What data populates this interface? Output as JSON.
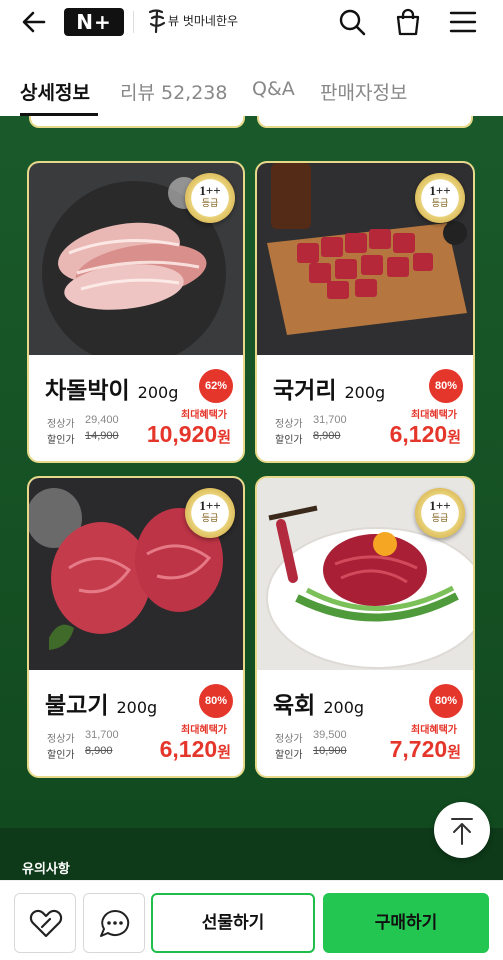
{
  "header": {
    "logo_text": "N+",
    "brand_name": "뷰 벗마네한우",
    "icons": [
      "back-arrow-icon",
      "search-icon",
      "shopping-bag-icon",
      "menu-icon"
    ]
  },
  "tabs": [
    {
      "label": "상세정보",
      "active": true
    },
    {
      "label": "리뷰 52,238",
      "active": false
    },
    {
      "label": "Q&A",
      "active": false
    },
    {
      "label": "판매자정보",
      "active": false
    }
  ],
  "badge": {
    "grade": "1++",
    "sub": "등급"
  },
  "labels": {
    "regular": "정상가",
    "discount": "할인가",
    "benefit": "최대혜택가",
    "won": "원"
  },
  "products": [
    {
      "name": "차돌박이",
      "weight": "200g",
      "percent": "62%",
      "regular_price": "29,400",
      "discount_price": "14,900",
      "final_price": "10,920"
    },
    {
      "name": "국거리",
      "weight": "200g",
      "percent": "80%",
      "regular_price": "31,700",
      "discount_price": "8,900",
      "final_price": "6,120"
    },
    {
      "name": "불고기",
      "weight": "200g",
      "percent": "80%",
      "regular_price": "31,700",
      "discount_price": "8,900",
      "final_price": "6,120"
    },
    {
      "name": "육회",
      "weight": "200g",
      "percent": "80%",
      "regular_price": "39,500",
      "discount_price": "10,900",
      "final_price": "7,720"
    }
  ],
  "notice": {
    "title": "유의사항"
  },
  "bottom_bar": {
    "gift_label": "선물하기",
    "buy_label": "구매하기"
  },
  "colors": {
    "accent_green": "#22c651",
    "sale_red": "#e5362b",
    "background_green": "#1a5a2a",
    "gold_border": "#e6d98a"
  }
}
